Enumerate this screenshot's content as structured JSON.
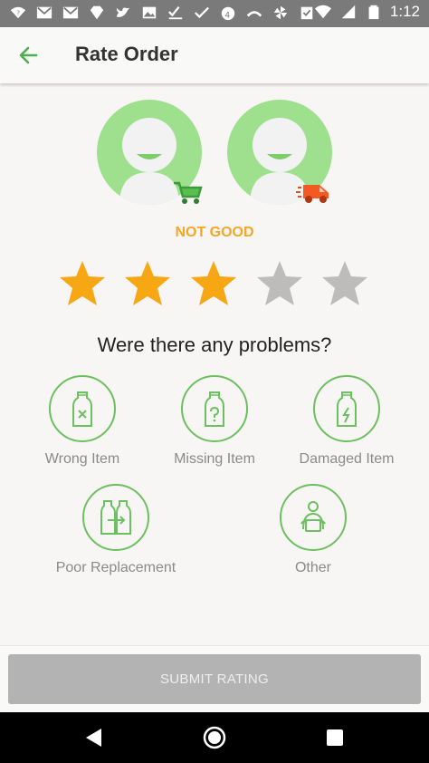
{
  "status_bar": {
    "time": "1:12",
    "icons": [
      "wifi-question-icon",
      "gmail-icon",
      "gmail-icon",
      "diamond-icon",
      "twitter-icon",
      "photo-icon",
      "checklist-icon",
      "check-icon",
      "krdn-news-icon",
      "missed-call-icon",
      "pinwheel-icon",
      "clipboard-check-icon",
      "wifi-icon",
      "signal-icon",
      "battery-icon"
    ]
  },
  "app_bar": {
    "title": "Rate Order",
    "back_icon": "arrow-left-icon"
  },
  "avatars": [
    {
      "badge_icon": "shopping-cart-icon"
    },
    {
      "badge_icon": "delivery-van-icon"
    }
  ],
  "rating": {
    "label": "NOT GOOD",
    "value": 3,
    "max": 5,
    "filled_color": "#f7a614",
    "empty_color": "#bdbcbb"
  },
  "problems": {
    "question": "Were there any problems?",
    "options": [
      {
        "label": "Wrong Item",
        "icon": "bottle-x-icon"
      },
      {
        "label": "Missing Item",
        "icon": "bottle-question-icon"
      },
      {
        "label": "Damaged Item",
        "icon": "bottle-broken-icon"
      },
      {
        "label": "Poor Replacement",
        "icon": "bottles-swap-icon"
      },
      {
        "label": "Other",
        "icon": "person-box-icon"
      }
    ]
  },
  "submit": {
    "label": "SUBMIT RATING"
  },
  "colors": {
    "accent_green": "#4caf50",
    "outline_green": "#6cc060",
    "avatar_green": "#9ee08d",
    "warning_orange": "#f5a623"
  }
}
